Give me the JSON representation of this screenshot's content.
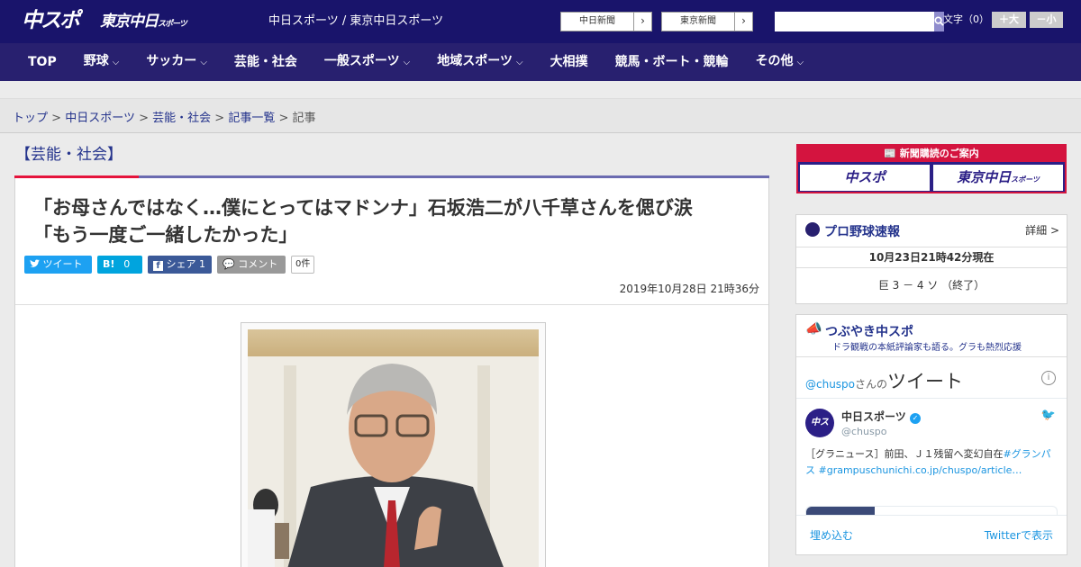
{
  "header": {
    "logo_chuspo": "中スポ",
    "logo_tokyo_main": "東京中日",
    "logo_tokyo_sub": "スポーツ",
    "site_name": "中日スポーツ / 東京中日スポーツ",
    "btn_chunichi": "中日新聞",
    "btn_tokyo": "東京新聞",
    "search_placeholder": "",
    "font_size_label": "文字（0）",
    "font_up": "＋大",
    "font_down": "－小"
  },
  "nav": [
    "TOP",
    "野球",
    "サッカー",
    "芸能・社会",
    "一般スポーツ",
    "地域スポーツ",
    "大相撲",
    "競馬・ボート・競輪",
    "その他"
  ],
  "breadcrumb": {
    "items": [
      "トップ",
      "中日スポーツ",
      "芸能・社会",
      "記事一覧"
    ],
    "current": "記事",
    "sep": ">"
  },
  "article": {
    "category": "【芸能・社会】",
    "title_line1": "「お母さんではなく…僕にとってはマドンナ」石坂浩二が八千草さんを偲び涙",
    "title_line2": "「もう一度ご一緒したかった」",
    "share": {
      "tweet": "ツイート",
      "hatena": "B!",
      "hatena_count": "0",
      "facebook": "シェア",
      "facebook_count": "1",
      "comment": "コメント",
      "comment_count": "0件"
    },
    "date": "2019年10月28日 21時36分"
  },
  "sidebar": {
    "subscription": {
      "title": "新聞購読のご案内",
      "logo1": "中スポ",
      "logo2": "東京中日",
      "logo2_sub": "スポーツ"
    },
    "baseball": {
      "title": "プロ野球速報",
      "detail": "詳細 >",
      "time": "10月23日21時42分現在",
      "score": "巨 3 － 4 ソ （終了）"
    },
    "twitter": {
      "title": "つぶやき中スポ",
      "subtitle": "ドラ観戦の本紙評論家も語る。グラも熱烈応援",
      "handle_prefix": "@chuspo",
      "handle_suffix": "さんの",
      "tweets_label": "ツイート",
      "user_name": "中日スポーツ",
      "user_handle": "@chuspo",
      "tweet_text": "［グラニュース］前田、Ｊ１残留へ変幻自在",
      "tweet_link": "#グランパス #grampuschunichi.co.jp/chuspo/article…",
      "embed": "埋め込む",
      "view_on": "Twitterで表示"
    }
  }
}
